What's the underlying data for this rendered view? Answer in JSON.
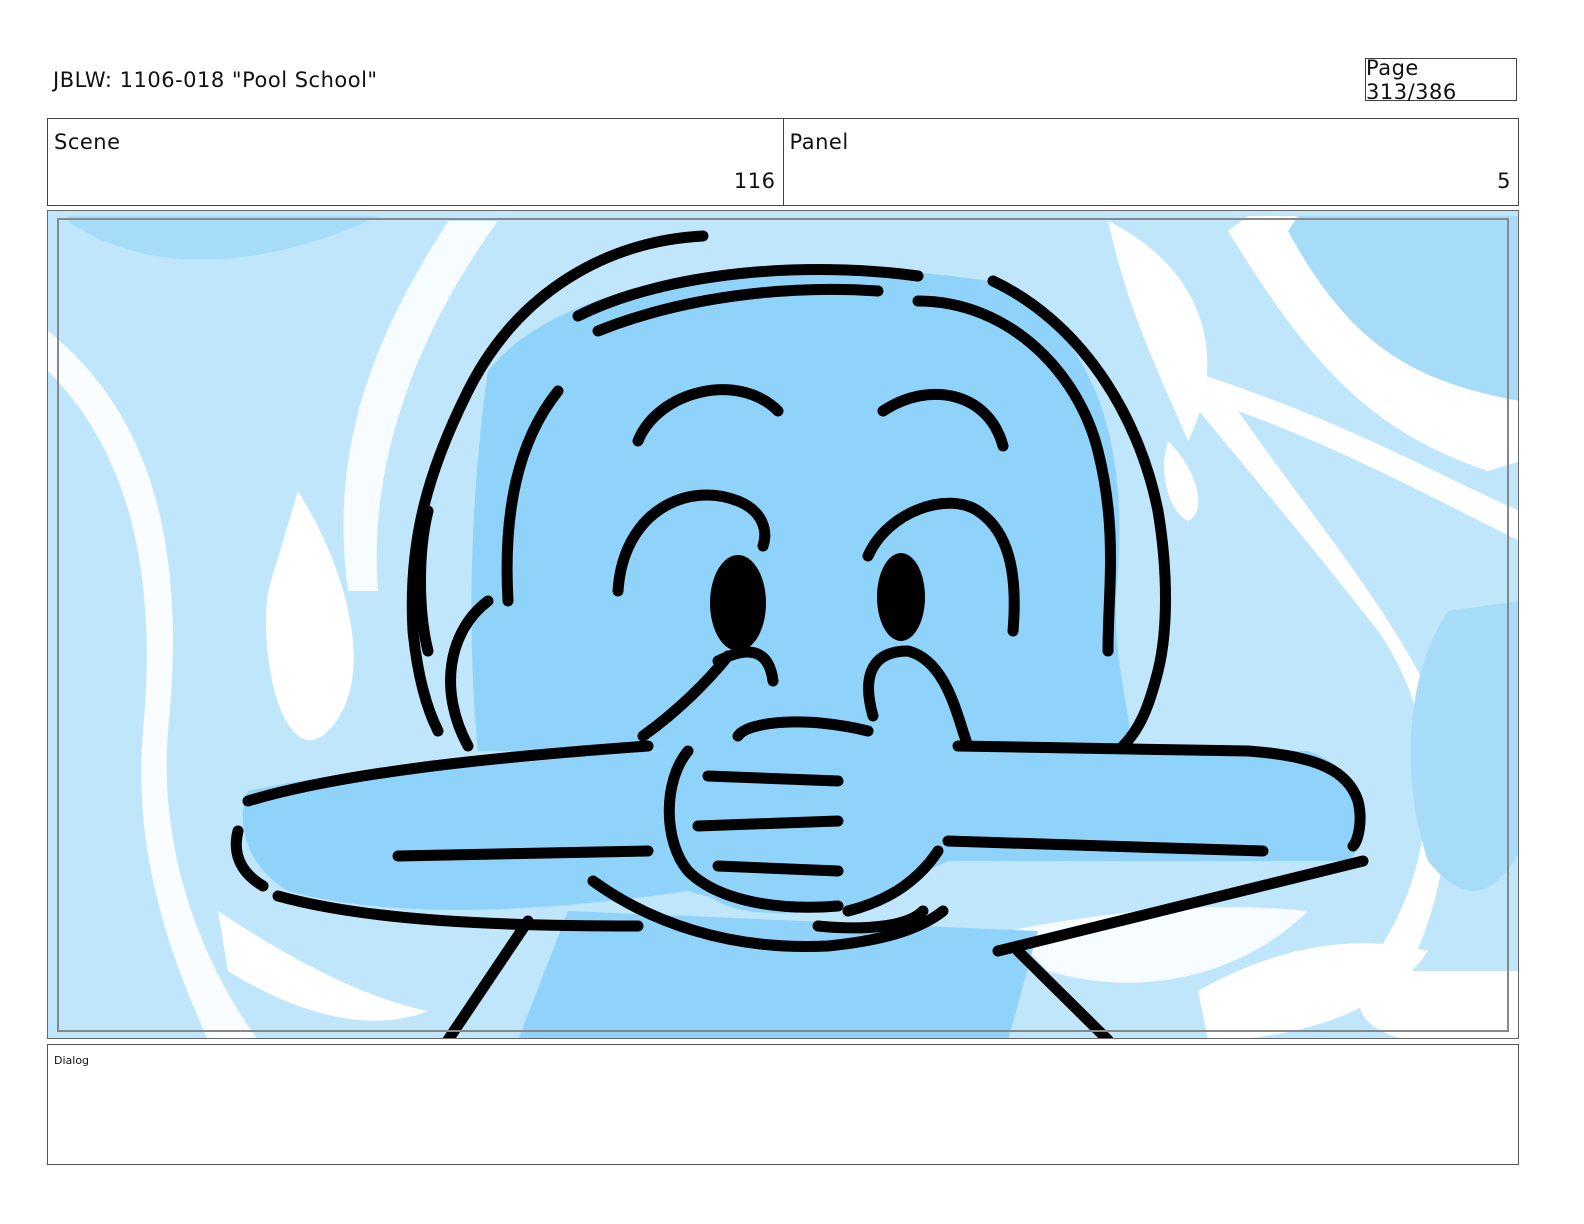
{
  "header": {
    "title": "JBLW: 1106-018 \"Pool School\"",
    "page": "Page 313/386"
  },
  "info": {
    "scene_label": "Scene",
    "scene_value": "116",
    "panel_label": "Panel",
    "panel_value": "5"
  },
  "dialog": {
    "label": "Dialog",
    "text": ""
  },
  "colors": {
    "water_light": "#bfe6fb",
    "water_mid": "#a6dcf8",
    "character_blue": "#8fd3fb",
    "ink": "#000000"
  }
}
